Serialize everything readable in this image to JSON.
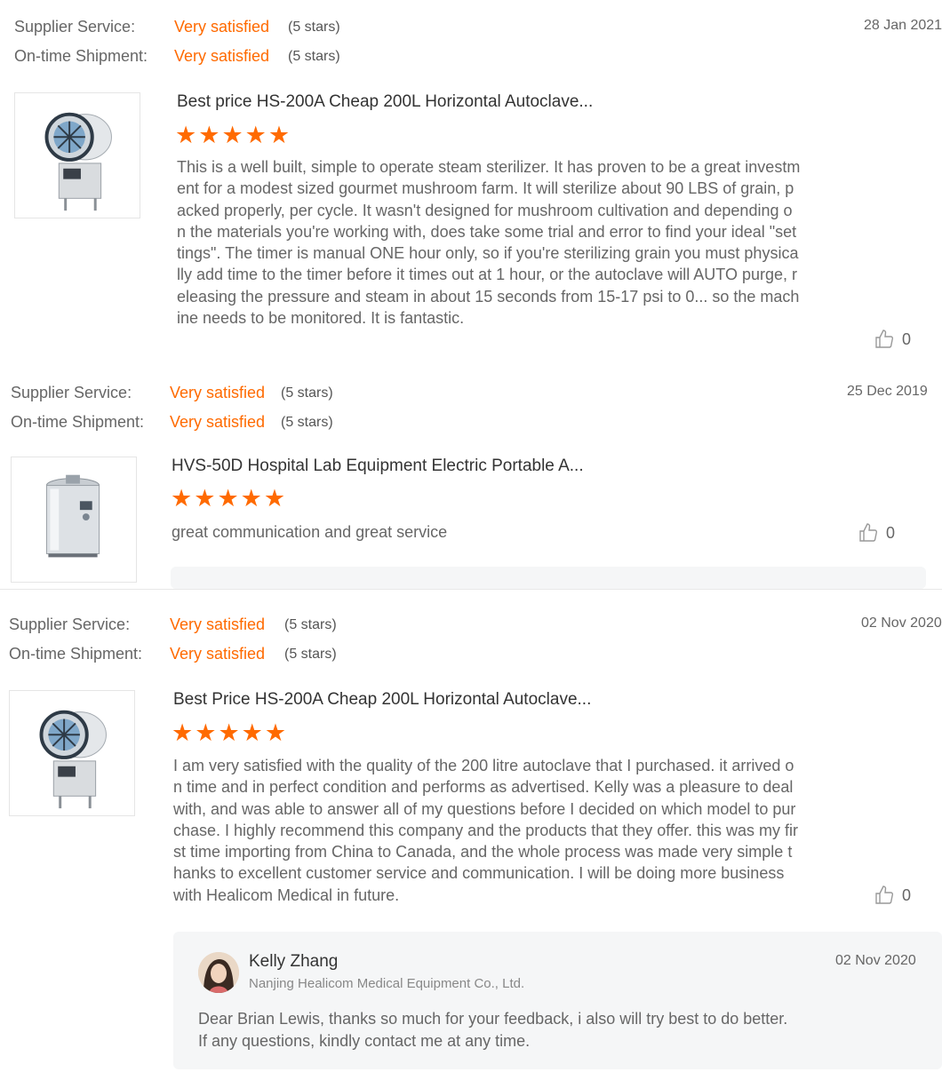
{
  "reviews": [
    {
      "supplier_label": "Supplier Service:",
      "supplier_value": "Very satisfied",
      "supplier_stars": "(5 stars)",
      "shipment_label": "On-time Shipment:",
      "shipment_value": "Very satisfied",
      "shipment_stars": "(5 stars)",
      "date": "28 Jan 2021",
      "product_icon": "horizontal-autoclave-icon",
      "product_title": "Best price HS-200A Cheap 200L Horizontal Autoclave...",
      "rating": 5,
      "text": "This is a well built, simple to operate steam sterilizer. It has proven to be a great investment for  a modest sized gourmet mushroom farm. It will sterilize about 90 LBS of grain, packed properly, per cycle.  It wasn't designed for mushroom cultivation and depending on the materials you're working with, does take some trial and error to find your ideal \"settings\".  The timer is manual ONE hour only, so if you're sterilizing grain you must physically add time to the timer before it times out at 1 hour, or the autoclave will AUTO purge, releasing the pressure and steam in about 15 seconds from 15-17 psi to 0... so the machine needs to be monitored.  It is fantastic.",
      "likes": "0"
    },
    {
      "supplier_label": "Supplier Service:",
      "supplier_value": "Very satisfied",
      "supplier_stars": "(5 stars)",
      "shipment_label": "On-time Shipment:",
      "shipment_value": "Very satisfied",
      "shipment_stars": "(5 stars)",
      "date": "25 Dec 2019",
      "product_icon": "vertical-autoclave-icon",
      "product_title": "HVS-50D Hospital Lab Equipment Electric Portable A...",
      "rating": 5,
      "text": "great communication and great service",
      "likes": "0"
    },
    {
      "supplier_label": "Supplier Service:",
      "supplier_value": "Very satisfied",
      "supplier_stars": "(5 stars)",
      "shipment_label": "On-time Shipment:",
      "shipment_value": "Very satisfied",
      "shipment_stars": "(5 stars)",
      "date": "02 Nov 2020",
      "product_icon": "horizontal-autoclave-icon",
      "product_title": "Best Price HS-200A Cheap 200L Horizontal Autoclave...",
      "rating": 5,
      "text": "I am very satisfied with the quality of the 200 litre  autoclave that I purchased. it arrived on time and in perfect condition and performs as advertised. Kelly was a pleasure to deal with, and was able to answer all of my questions before I decided on which model to purchase. I highly recommend this company and the products that they offer. this was my first time importing from China to Canada, and the whole process was made very simple thanks to excellent customer service and communication. I will be doing more business with Healicom Medical in future.",
      "likes": "0",
      "reply": {
        "name": "Kelly Zhang",
        "company": "Nanjing Healicom Medical Equipment Co., Ltd.",
        "date": "02 Nov 2020",
        "line1": "Dear Brian Lewis, thanks so much for your feedback, i also will try best to do better.",
        "line2": "If any questions, kindly contact me at any time."
      }
    }
  ],
  "colors": {
    "accent": "#ff6a00",
    "text": "#666666",
    "title": "#333333",
    "reply_bg": "#f5f6f7"
  },
  "icons": {
    "star": "star-icon",
    "like": "thumbs-up-icon"
  }
}
